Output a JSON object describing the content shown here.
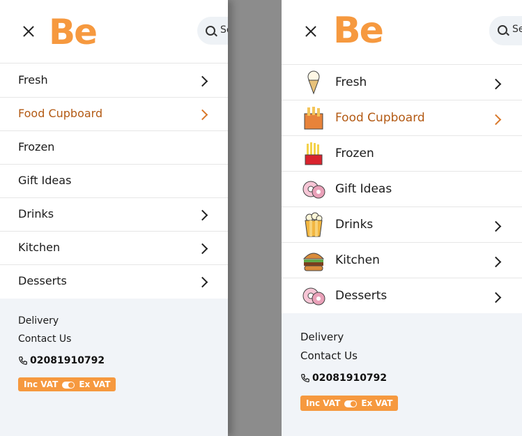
{
  "brand": {
    "logo": "Be",
    "search_placeholder": "Se"
  },
  "menu": [
    {
      "label": "Fresh",
      "has_submenu": true,
      "icon": "ice-cream-icon"
    },
    {
      "label": "Food Cupboard",
      "has_submenu": true,
      "active": true,
      "icon": "fries-bag-icon"
    },
    {
      "label": "Frozen",
      "has_submenu": false,
      "icon": "fries-icon"
    },
    {
      "label": "Gift Ideas",
      "has_submenu": false,
      "icon": "donut-icon"
    },
    {
      "label": "Drinks",
      "has_submenu": true,
      "icon": "popcorn-icon"
    },
    {
      "label": "Kitchen",
      "has_submenu": true,
      "icon": "burger-icon"
    },
    {
      "label": "Desserts",
      "has_submenu": true,
      "icon": "donut-icon"
    }
  ],
  "footer": {
    "delivery": "Delivery",
    "contact": "Contact Us",
    "phone": "02081910792",
    "vat_inc": "Inc VAT",
    "vat_ex": "Ex VAT"
  },
  "colors": {
    "accent": "#f6993f",
    "active_text": "#b35a14",
    "footer_bg": "#f1f4f8"
  }
}
